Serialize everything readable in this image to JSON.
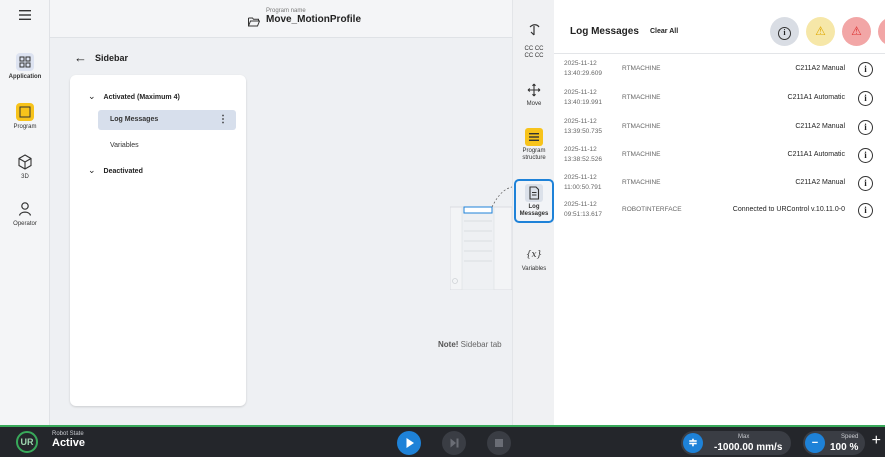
{
  "nav": {
    "items": [
      {
        "label": "Application",
        "icon": "grid-icon"
      },
      {
        "label": "Program",
        "icon": "program-icon"
      },
      {
        "label": "3D",
        "icon": "cube-icon"
      },
      {
        "label": "Operator",
        "icon": "person-icon"
      }
    ]
  },
  "header": {
    "program_caption": "Program name",
    "program_name": "Move_MotionProfile"
  },
  "sidebar_settings": {
    "title": "Sidebar",
    "activated_label": "Activated (Maximum 4)",
    "activated_items": [
      "Log Messages",
      "Variables"
    ],
    "deactivated_label": "Deactivated",
    "note_bold": "Note!",
    "note_text": " Sidebar tab"
  },
  "tools": {
    "items": [
      {
        "label": "",
        "icon": "pointer-icon"
      },
      {
        "label": "",
        "icon": "cc-icon",
        "glyph": "CC CC\nCC CC"
      },
      {
        "label": "Move",
        "icon": "move-icon"
      },
      {
        "label": "Program structure",
        "icon": "program-structure-icon"
      },
      {
        "label": "Log Messages",
        "icon": "log-messages-icon"
      },
      {
        "label": "Variables",
        "icon": "variables-icon",
        "glyph": "{x}"
      }
    ]
  },
  "log": {
    "title": "Log Messages",
    "clear_all": "Clear All",
    "filters": [
      {
        "name": "info",
        "color": "#d9dde4"
      },
      {
        "name": "warning",
        "color": "#f6e7a8"
      },
      {
        "name": "error",
        "color": "#f2a6a6"
      },
      {
        "name": "fault",
        "color": "#f2a6a6"
      }
    ],
    "entries": [
      {
        "date": "2025-11-12",
        "time": "13:40:29.609",
        "source": "RTMACHINE",
        "message": "C211A2 Manual"
      },
      {
        "date": "2025-11-12",
        "time": "13:40:19.991",
        "source": "RTMACHINE",
        "message": "C211A1 Automatic"
      },
      {
        "date": "2025-11-12",
        "time": "13:39:50.735",
        "source": "RTMACHINE",
        "message": "C211A2 Manual"
      },
      {
        "date": "2025-11-12",
        "time": "13:38:52.526",
        "source": "RTMACHINE",
        "message": "C211A1 Automatic"
      },
      {
        "date": "2025-11-12",
        "time": "11:00:50.791",
        "source": "RTMACHINE",
        "message": "C211A2 Manual"
      },
      {
        "date": "2025-11-12",
        "time": "09:51:13.617",
        "source": "ROBOTINTERFACE",
        "message": "Connected to URControl v.10.11.0-0"
      }
    ]
  },
  "status_bar": {
    "robot_state_caption": "Robot State",
    "robot_state": "Active",
    "max_caption": "Max",
    "max_value": "-1000.00 mm/s",
    "speed_caption": "Speed",
    "speed_value": "100 %",
    "accent_color": "#38a95a"
  }
}
